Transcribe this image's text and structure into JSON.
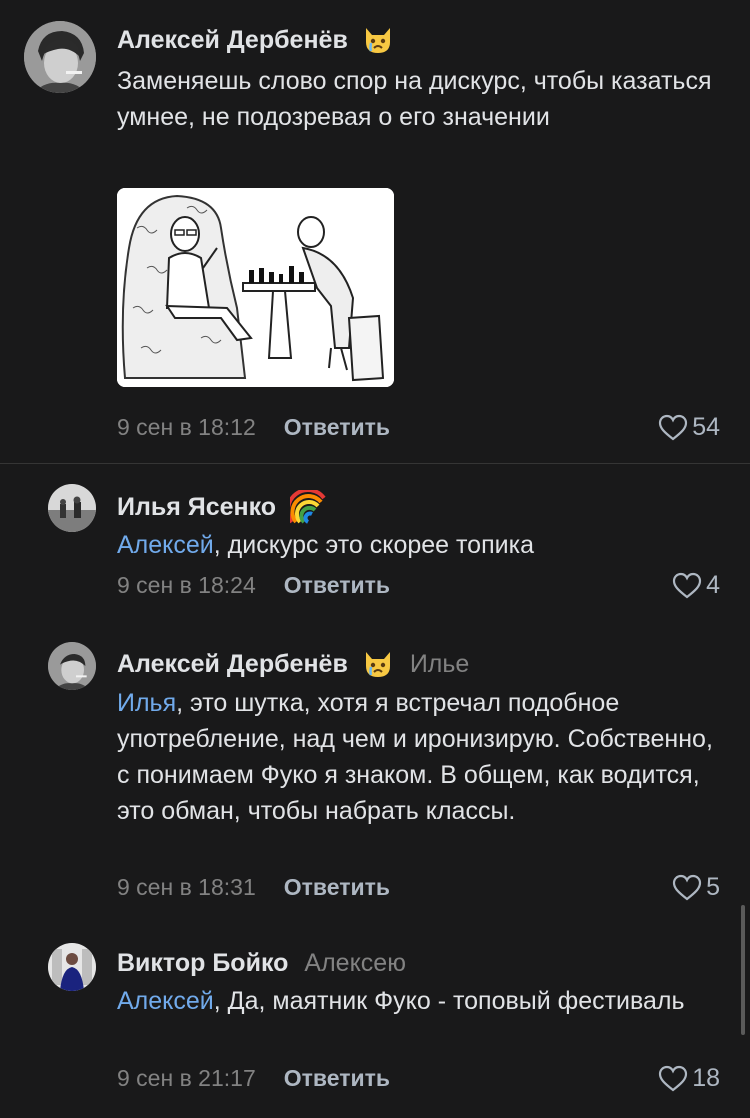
{
  "comments": [
    {
      "author": "Алексей Дербенёв",
      "emoji": "crying-cat-icon",
      "text": "Заменяешь слово спор на дискурс, чтобы казаться умнее, не подозревая о его значении",
      "time": "9 сен в 18:12",
      "reply_label": "Ответить",
      "likes": "54",
      "image": "chess-meme-image"
    },
    {
      "author": "Илья Ясенко",
      "emoji": "rainbow-icon",
      "mention": "Алексей",
      "text": ", дискурс это скорее топика",
      "time": "9 сен в 18:24",
      "reply_label": "Ответить",
      "likes": "4"
    },
    {
      "author": "Алексей Дербенёв",
      "emoji": "crying-cat-icon",
      "reply_to": "Илье",
      "mention": "Илья",
      "text": ", это шутка, хотя я встречал подобное употребление, над чем и иронизирую. Собственно, с понимаем Фуко я знаком. В общем, как водится, это обман, чтобы набрать классы.",
      "time": "9 сен в 18:31",
      "reply_label": "Ответить",
      "likes": "5"
    },
    {
      "author": "Виктор Бойко",
      "reply_to": "Алексею",
      "mention": "Алексей",
      "text": ", Да, маятник Фуко - топовый фестиваль",
      "time": "9 сен в 21:17",
      "reply_label": "Ответить",
      "likes": "18"
    }
  ],
  "colors": {
    "background": "#19191a",
    "text": "#e1e3e6",
    "secondary": "#828282",
    "mention": "#71aaeb",
    "action": "#aeb7c2"
  }
}
